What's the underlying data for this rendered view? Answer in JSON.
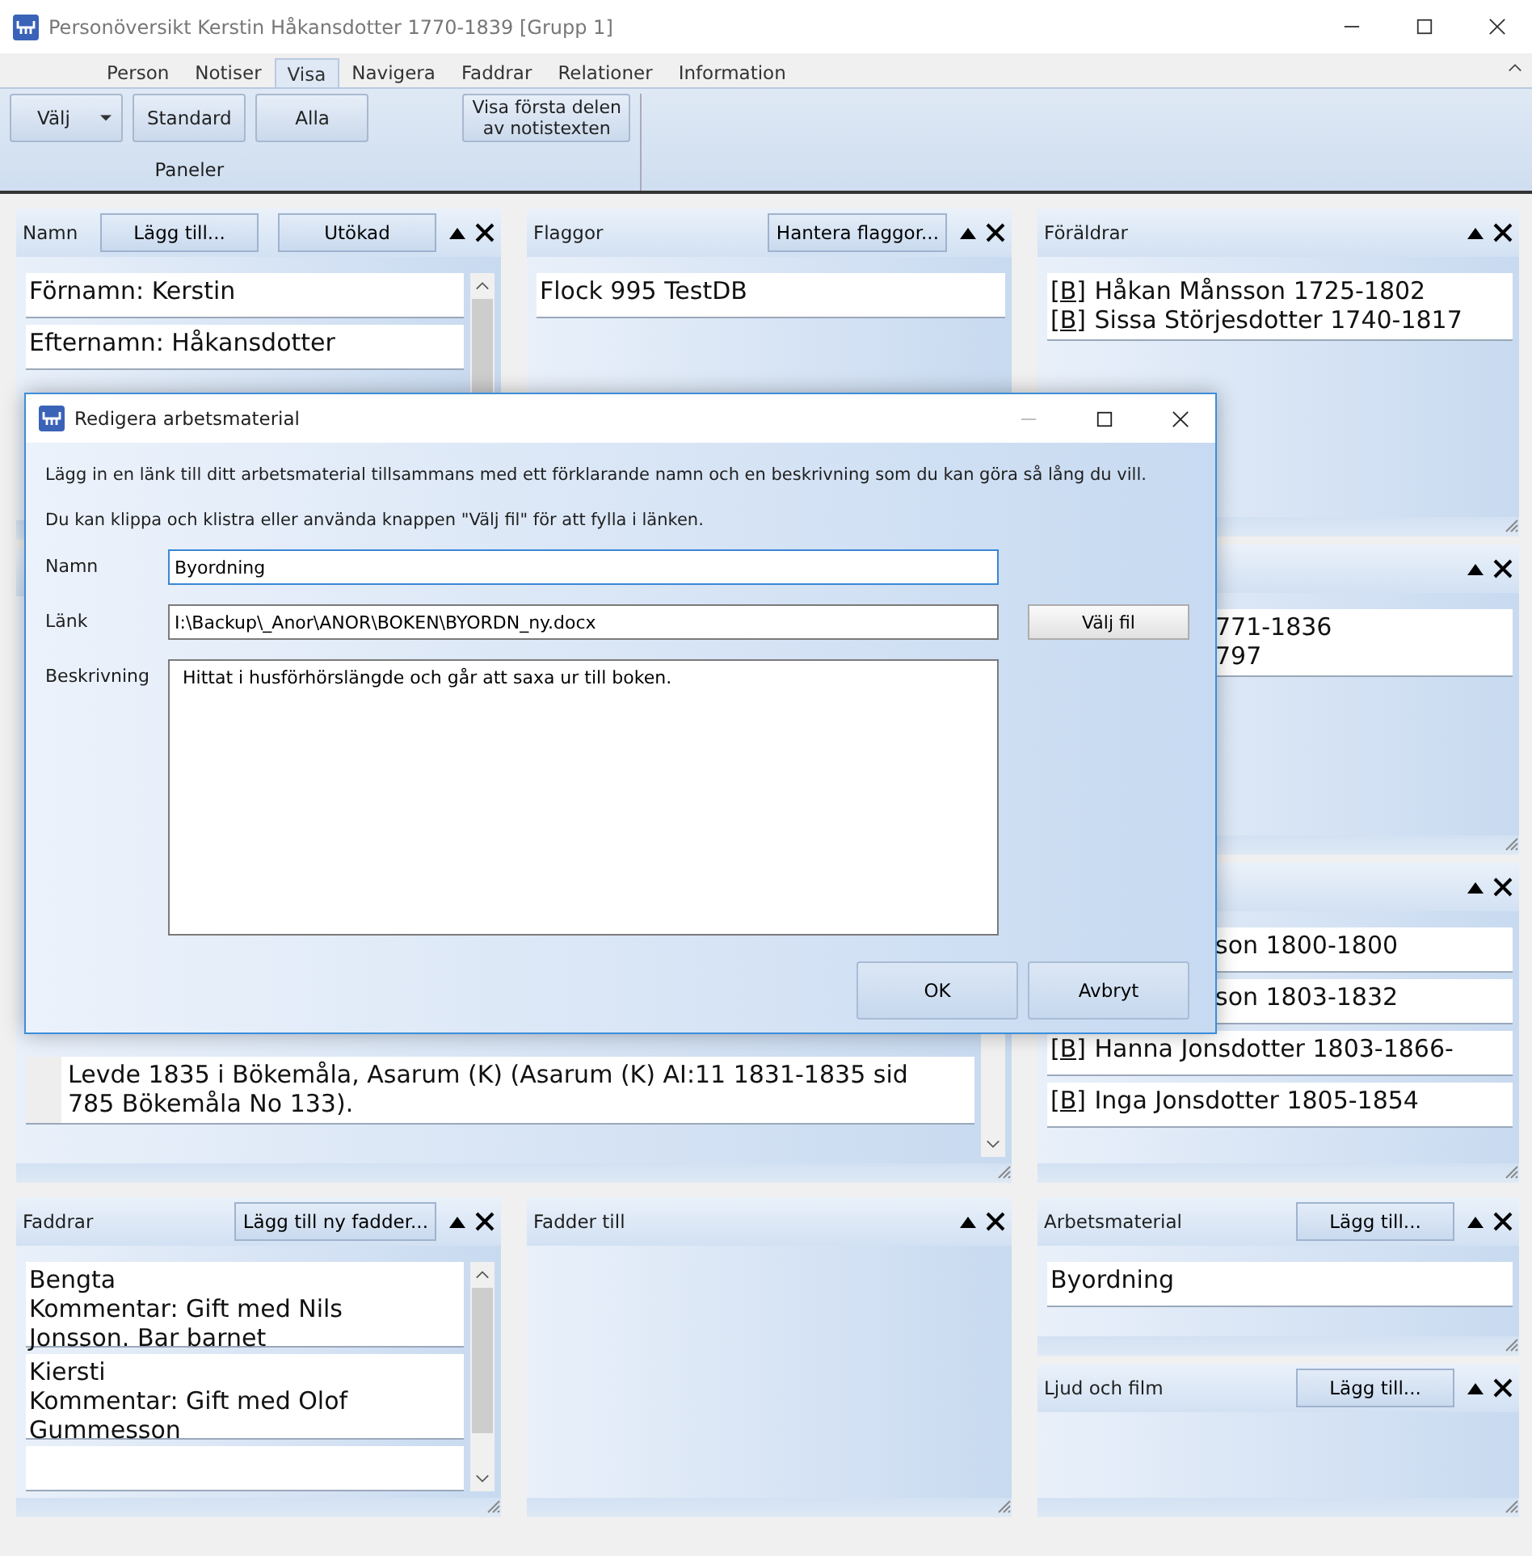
{
  "window": {
    "title": "Personöversikt Kerstin Håkansdotter 1770-1839 [Grupp 1]"
  },
  "tabs": [
    {
      "label": "Person",
      "selected": false
    },
    {
      "label": "Notiser",
      "selected": false
    },
    {
      "label": "Visa",
      "selected": true
    },
    {
      "label": "Navigera",
      "selected": false
    },
    {
      "label": "Faddrar",
      "selected": false
    },
    {
      "label": "Relationer",
      "selected": false
    },
    {
      "label": "Information",
      "selected": false
    }
  ],
  "ribbon": {
    "groups": [
      {
        "label": "Paneler",
        "buttons": [
          {
            "label": "Välj",
            "kind": "dropdown"
          },
          {
            "label": "Standard",
            "kind": "plain"
          },
          {
            "label": "Alla",
            "kind": "plain"
          }
        ]
      },
      {
        "buttons": [
          {
            "label": "Visa första delen av notistexten",
            "kind": "plain"
          }
        ]
      }
    ]
  },
  "left": {
    "top": [
      {
        "title": "Namn",
        "buttons": [
          "Lägg till...",
          "Utökad"
        ],
        "kind": "scroll-list",
        "rows": [
          {
            "kind": "plain",
            "lines": [
              {
                "text": "Förnamn: Kerstin"
              }
            ]
          },
          {
            "kind": "plain",
            "lines": [
              {
                "text": "Efternamn: Håkansdotter"
              }
            ]
          }
        ]
      },
      {
        "title": "Flaggor",
        "buttons": [
          "Hantera flaggor..."
        ],
        "kind": "list",
        "rows": [
          {
            "kind": "plain",
            "lines": [
              {
                "text": "Flock 995 TestDB"
              }
            ]
          }
        ]
      }
    ],
    "notes": {
      "kind": "scroll-list",
      "lower_rows": [
        {
          "kind": "gutter",
          "lines": [
            {
              "text": "Levde 1835 i Bökemåla, Asarum (K) (Asarum (K) AI:11 1831-1835 sid"
            },
            {
              "text": "785 Bökemåla No 133)."
            }
          ]
        }
      ]
    },
    "bottom": [
      {
        "title": "Faddrar",
        "buttons": [
          "Lägg till ny fadder..."
        ],
        "kind": "scroll-list",
        "rows": [
          {
            "kind": "plain",
            "lines": [
              {
                "text": "Bengta"
              },
              {
                "text": "Kommentar: Gift med Nils"
              },
              {
                "text": "Jonsson. Bar barnet"
              }
            ]
          },
          {
            "kind": "plain",
            "lines": [
              {
                "text": "Kiersti"
              },
              {
                "text": "Kommentar: Gift med Olof"
              },
              {
                "text": "Gummesson"
              }
            ]
          },
          {
            "kind": "plain",
            "lines": []
          }
        ]
      },
      {
        "title": "Fadder till",
        "kind": "list"
      }
    ]
  },
  "right": [
    {
      "title": "Föräldrar",
      "kind": "list",
      "rows": [
        {
          "kind": "plain",
          "lines": [
            {
              "link": "[B]",
              "text": "Håkan Månsson 1725-1802"
            },
            {
              "link": "[B]",
              "text": "Sissa Störjesdotter 1740-1817"
            }
          ]
        }
      ]
    },
    {
      "kind": "list",
      "rows": [
        {
          "kind": "covered",
          "lines": [
            {
              "text": "771-1836"
            },
            {
              "text": "797"
            }
          ]
        }
      ]
    },
    {
      "kind": "list",
      "rows": [
        {
          "kind": "covered",
          "lines": [
            {
              "text": "son 1800-1800"
            }
          ]
        },
        {
          "kind": "covered",
          "lines": [
            {
              "text": "son 1803-1832"
            }
          ]
        },
        {
          "kind": "plain",
          "lines": [
            {
              "link": "[B]",
              "text": "Hanna Jonsdotter 1803-1866-"
            }
          ]
        },
        {
          "kind": "plain",
          "lines": [
            {
              "link": "[B]",
              "text": "Inga Jonsdotter 1805-1854"
            }
          ]
        }
      ]
    },
    {
      "title": "Arbetsmaterial",
      "buttons": [
        "Lägg till..."
      ],
      "kind": "list",
      "rows": [
        {
          "kind": "plain",
          "lines": [
            {
              "text": "Byordning"
            }
          ]
        }
      ]
    },
    {
      "title": "Ljud och film",
      "buttons": [
        "Lägg till..."
      ],
      "kind": "list"
    }
  ],
  "dialog": {
    "title": "Redigera arbetsmaterial",
    "intro": [
      "Lägg in en länk till ditt arbetsmaterial tillsammans med ett förklarande namn och en beskrivning som du kan göra så lång du vill.",
      "Du kan klippa och klistra eller använda knappen \"Välj fil\" för att fylla i länken."
    ],
    "fields": [
      {
        "label": "Namn",
        "value": "Byordning",
        "kind": "text",
        "focused": true
      },
      {
        "label": "Länk",
        "value": "I:\\Backup\\_Anor\\ANOR\\BOKEN\\BYORDN_ny.docx",
        "kind": "text",
        "focused": false,
        "button": "Välj fil"
      },
      {
        "label": "Beskrivning",
        "value": "Hittat i husförhörslängde och går att saxa ur till boken.",
        "kind": "multiline",
        "focused": false
      }
    ],
    "buttons": [
      "OK",
      "Avbryt"
    ]
  }
}
